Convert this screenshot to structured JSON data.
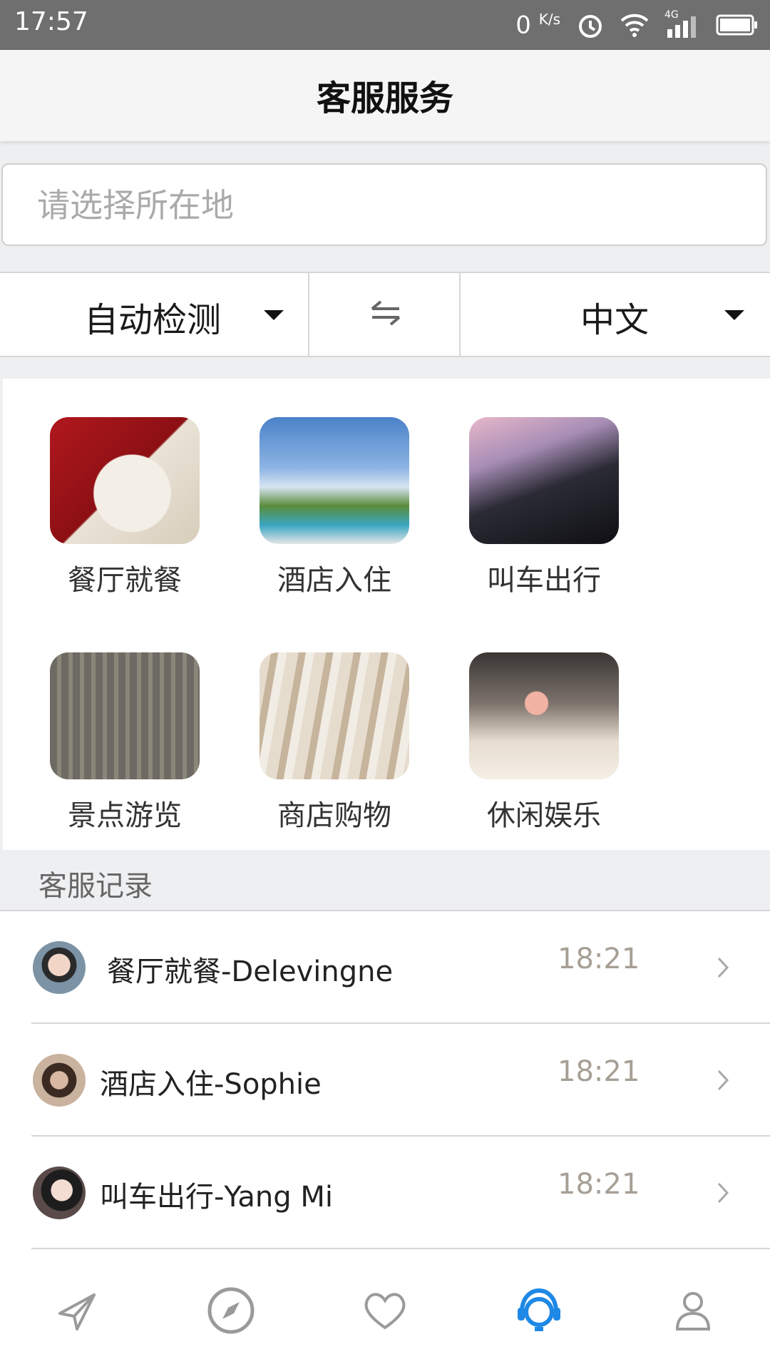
{
  "status_bar": {
    "time": "17:57",
    "net_speed_value": "0",
    "net_speed_unit": "K/s",
    "network_type": "4G"
  },
  "header": {
    "title": "客服服务"
  },
  "location": {
    "placeholder": "请选择所在地",
    "value": ""
  },
  "language": {
    "source": "自动检测",
    "target": "中文"
  },
  "categories": [
    {
      "label": "餐厅就餐",
      "icon": "dining-photo"
    },
    {
      "label": "酒店入住",
      "icon": "hotel-photo"
    },
    {
      "label": "叫车出行",
      "icon": "taxi-photo"
    },
    {
      "label": "景点游览",
      "icon": "scenic-photo"
    },
    {
      "label": "商店购物",
      "icon": "shopping-photo"
    },
    {
      "label": "休闲娱乐",
      "icon": "leisure-photo"
    }
  ],
  "records": {
    "title": "客服记录",
    "items": [
      {
        "name": "餐厅就餐-Delevingne",
        "time": "18:21"
      },
      {
        "name": "酒店入住-Sophie",
        "time": "18:21"
      },
      {
        "name": "叫车出行-Yang Mi",
        "time": "18:21"
      }
    ]
  },
  "bottom_nav": {
    "items": [
      {
        "icon": "send-icon",
        "active": false
      },
      {
        "icon": "compass-icon",
        "active": false
      },
      {
        "icon": "heart-icon",
        "active": false
      },
      {
        "icon": "customer-service-icon",
        "active": true
      },
      {
        "icon": "user-icon",
        "active": false
      }
    ],
    "active_color": "#1e88e5",
    "inactive_color": "#9a9a9a"
  }
}
